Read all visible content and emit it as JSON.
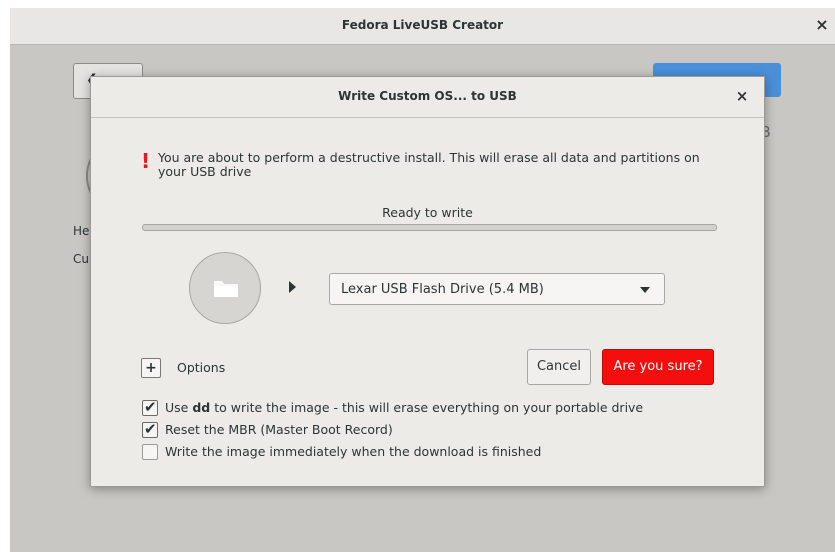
{
  "main_window": {
    "title": "Fedora LiveUSB Creator",
    "close_glyph": "×",
    "back_glyph": "❮",
    "peek_usb_text": "SB",
    "peek_he_text": "He",
    "peek_cu_text": "Cu"
  },
  "dialog": {
    "title": "Write Custom OS... to USB",
    "close_glyph": "×",
    "warning_icon": "!",
    "warning_text": "You are about to perform a destructive install. This will erase all data and partitions on your USB drive",
    "status": "Ready to write",
    "progress": 0,
    "drive_select": {
      "selected": "Lexar USB Flash Drive (5.4 MB)"
    },
    "options_toggle": "+",
    "options_label": "Options",
    "cancel_label": "Cancel",
    "confirm_label": "Are you sure?",
    "checkboxes": [
      {
        "pre": "Use ",
        "bold": "dd",
        "post": " to write the image - this will erase everything on your portable drive",
        "checked": true
      },
      {
        "pre": "Reset the MBR (Master Boot Record)",
        "bold": "",
        "post": "",
        "checked": true
      },
      {
        "pre": "Write the image immediately when the download is finished",
        "bold": "",
        "post": "",
        "checked": false
      }
    ]
  },
  "icons": {
    "folder": "folder-icon",
    "dropdown": "chevron-down-icon",
    "arrow": "arrow-right-icon",
    "warning": "warning-icon",
    "check": "check-icon"
  },
  "colors": {
    "accent_blue": "#4a90d9",
    "destructive_red": "#f50e0e",
    "warning_red": "#e01b24",
    "dialog_bg": "#ecebe8",
    "window_bg": "#c9c7c3"
  }
}
